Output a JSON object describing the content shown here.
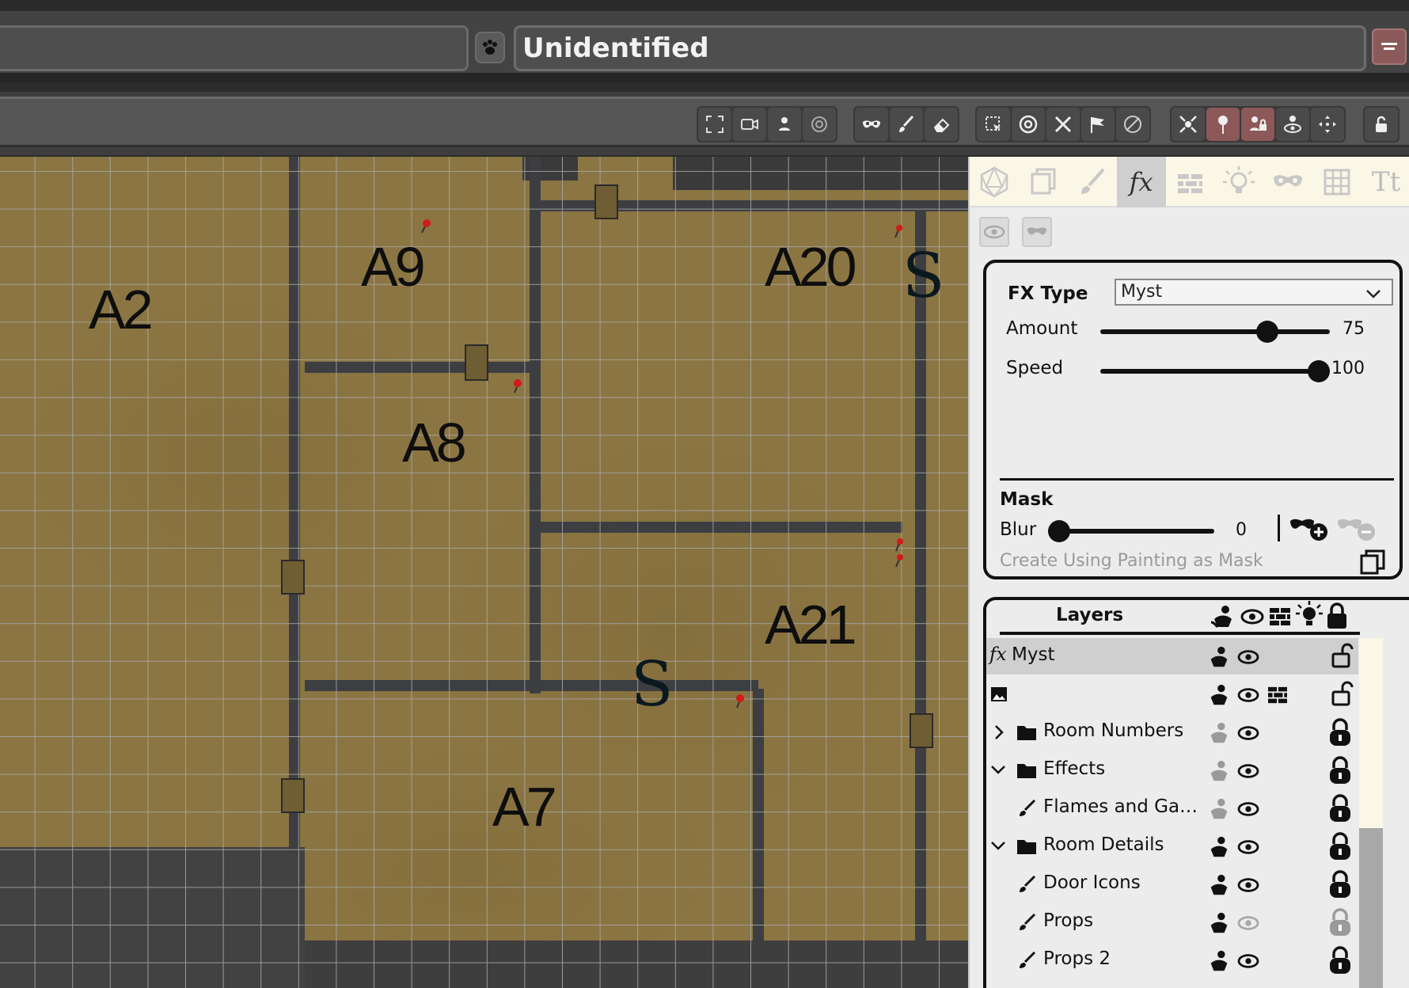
{
  "window": {
    "title": "Unidentified"
  },
  "toolbar": {
    "groups": [
      [
        "fit-to-screen-icon",
        "camera-icon",
        "token-icon",
        "target-icon"
      ],
      [
        "mask-icon",
        "brush-icon",
        "eraser-icon"
      ],
      [
        "select-area-icon",
        "ring-icon",
        "cross-swords-icon",
        "flag-icon",
        "no-vision-icon"
      ],
      [
        "burst-icon",
        "pin-icon",
        "lock-person-icon",
        "eye-person-icon",
        "move-icon"
      ],
      [
        "unlock-icon"
      ]
    ]
  },
  "map": {
    "rooms": [
      "A2",
      "A9",
      "A20",
      "A8",
      "A21",
      "A7"
    ],
    "secret_doors": [
      "S",
      "S"
    ]
  },
  "panel": {
    "tabs": [
      "d20-icon",
      "copy-icon",
      "brush-icon",
      "fx-icon",
      "wall-icon",
      "light-icon",
      "mask-icon",
      "grid-icon",
      "text-icon"
    ],
    "tab_text": "Tt",
    "fx_label": "fx",
    "fx": {
      "type_label": "FX Type",
      "type_value": "Myst",
      "amount_label": "Amount",
      "amount_value": "75",
      "amount_fraction": 0.75,
      "speed_label": "Speed",
      "speed_value": "100",
      "speed_fraction": 1.0
    },
    "mask": {
      "title": "Mask",
      "blur_label": "Blur",
      "blur_value": "0",
      "create_hint": "Create Using Painting as Mask"
    },
    "layers": {
      "title": "Layers",
      "rows": [
        {
          "prefix": "fx",
          "name": "Myst",
          "selected": true
        },
        {
          "prefix": "image",
          "name": ""
        },
        {
          "prefix": "folder",
          "name": "Room Numbers",
          "expander": ">"
        },
        {
          "prefix": "folder",
          "name": "Effects",
          "expander": "v"
        },
        {
          "prefix": "brush",
          "name": "Flames and Ga…"
        },
        {
          "prefix": "folder",
          "name": "Room Details",
          "expander": "v"
        },
        {
          "prefix": "brush",
          "name": "Door Icons"
        },
        {
          "prefix": "brush",
          "name": "Props"
        },
        {
          "prefix": "brush",
          "name": "Props 2"
        }
      ]
    }
  },
  "colors": {
    "accent_active": "#8c5858",
    "panel_bg": "#ececec",
    "tab_bg": "#fbf7e6",
    "map_floor": "#8a7440",
    "pin": "#d11a1a"
  }
}
